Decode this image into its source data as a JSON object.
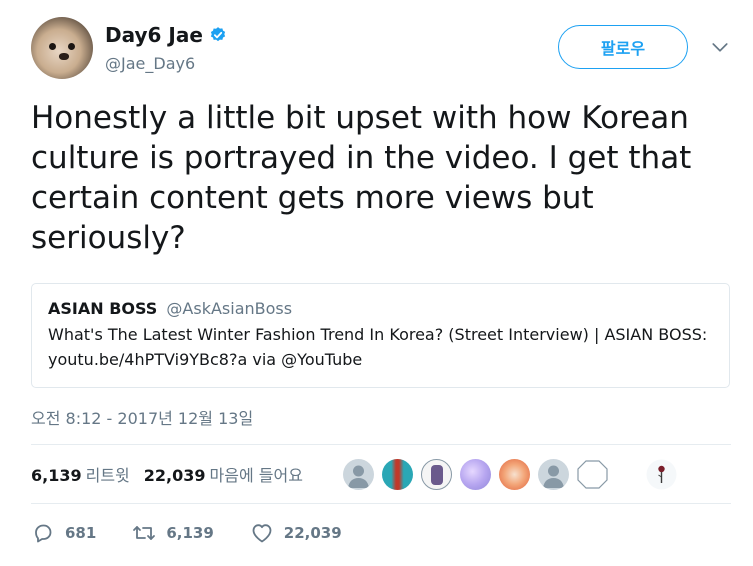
{
  "author": {
    "display_name": "Day6 Jae",
    "handle": "@Jae_Day6",
    "verified_icon": "verified-badge-icon"
  },
  "follow_button": {
    "label": "팔로우"
  },
  "tweet": {
    "text": "Honestly a little bit upset with how Korean culture is portrayed in the video. I get that certain content gets more views but seriously?"
  },
  "quoted_card": {
    "name": "ASIAN BOSS",
    "handle": "@AskAsianBoss",
    "line1": "What's The Latest Winter Fashion Trend In Korea? (Street Interview) | ASIAN BOSS:",
    "line2": "youtu.be/4hPTVi9YBc8?a via @YouTube"
  },
  "timestamp": "오전 8:12 - 2017년 12월 13일",
  "stats": {
    "retweets_count": "6,139",
    "retweets_label": "리트윗",
    "likes_count": "22,039",
    "likes_label": "마음에 들어요"
  },
  "actions": {
    "replies": "681",
    "retweets": "6,139",
    "likes": "22,039"
  },
  "colors": {
    "accent": "#1da1f2",
    "text": "#14171a",
    "muted": "#657786",
    "border": "#e1e8ed"
  }
}
